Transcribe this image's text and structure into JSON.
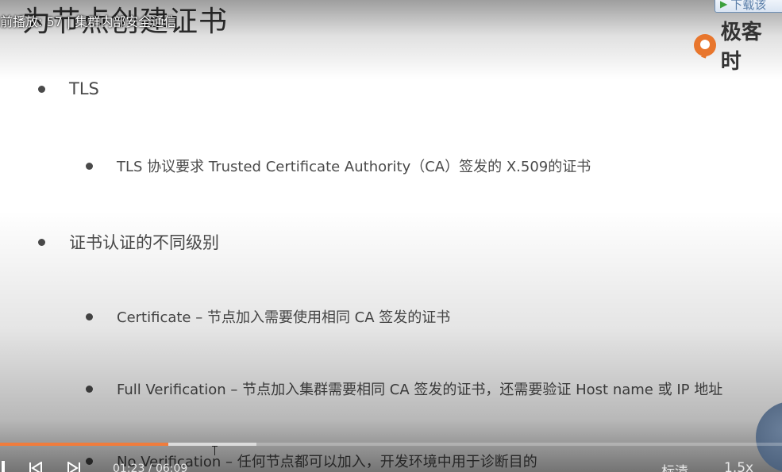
{
  "player": {
    "playing_title": "前播放: 57 | 集群内部安全通信",
    "download_button": "下载该",
    "brand_name": "极客时",
    "time_display": "01:23 / 06:09",
    "quality_label": "标清",
    "speed_label": "1.5x",
    "progress": {
      "played_fraction": 0.215,
      "buffered_fraction": 0.328
    },
    "colors": {
      "progress_played": "#f07c3c",
      "accent": "#e8762d"
    }
  },
  "slide": {
    "title": "为节点创建证书",
    "bullets": [
      {
        "level": 1,
        "text": "TLS"
      },
      {
        "level": 2,
        "text": "TLS 协议要求 Trusted Certificate Authority（CA）签发的 X.509的证书"
      },
      {
        "level": 1,
        "text": "证书认证的不同级别"
      },
      {
        "level": 2,
        "text": "Certificate – 节点加入需要使用相同 CA 签发的证书"
      },
      {
        "level": 2,
        "text": "Full Verification – 节点加入集群需要相同 CA 签发的证书，还需要验证 Host name 或 IP 地址"
      },
      {
        "level": 2,
        "text": "No Verification – 任何节点都可以加入，开发环境中用于诊断目的"
      }
    ]
  }
}
